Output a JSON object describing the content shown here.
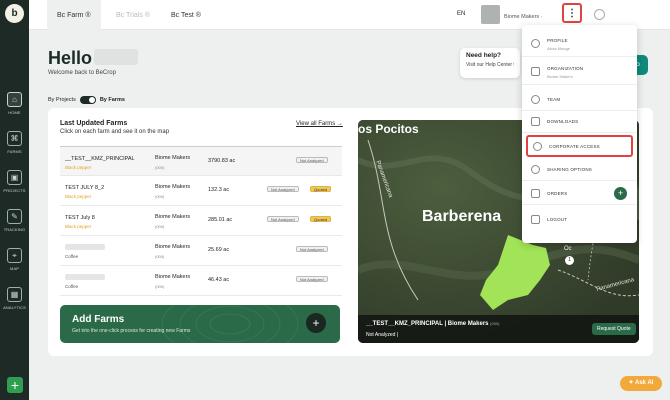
{
  "app": {
    "logo_letter": "b"
  },
  "sidebar": {
    "items": [
      {
        "label": "HOME",
        "icon": "home-icon",
        "glyph": "⌂"
      },
      {
        "label": "FARMS",
        "icon": "farms-icon",
        "glyph": "⌘"
      },
      {
        "label": "PROJECTS",
        "icon": "projects-icon",
        "glyph": "▣"
      },
      {
        "label": "TRACKING",
        "icon": "tracking-icon",
        "glyph": "✎"
      },
      {
        "label": "MAP",
        "icon": "map-icon",
        "glyph": "⌖"
      },
      {
        "label": "ANALYTICS",
        "icon": "analytics-icon",
        "glyph": "▦"
      }
    ],
    "add_glyph": "+"
  },
  "topbar": {
    "tabs": [
      {
        "label": "Bc Farm ®",
        "active": true
      },
      {
        "label": "Bc Trials ®",
        "active": false
      },
      {
        "label": "Bc Test ®",
        "active": false
      }
    ],
    "language": "EN",
    "account": "Biome Makers · ",
    "kebab": "⋮"
  },
  "home": {
    "greeting": "Hello",
    "welcome": "Welcome back to BeCrop",
    "toggle_left": "By Projects",
    "toggle_right": "By Farms"
  },
  "help": {
    "title": "Need help?",
    "subtitle": "Visit our Help Center f",
    "button_glyph": "⌕"
  },
  "farms_card": {
    "title": "Last Updated Farms",
    "subtitle": "Click on each farm and see it on the map",
    "view_all": "View all Farms →",
    "rows": [
      {
        "name": "__TEST__KMZ_PRINCIPAL",
        "crop": "Black pepper",
        "org": "Biome Makers",
        "org_sub": "(000)",
        "area": "3790.83 ac",
        "status": "Not Analyzed",
        "quoted": ""
      },
      {
        "name": "TEST JULY 8_2",
        "crop": "Black pepper",
        "org": "Biome Makers",
        "org_sub": "(000)",
        "area": "132.3 ac",
        "status": "Not Analyzed",
        "quoted": "Quoted"
      },
      {
        "name": "TEST July 8",
        "crop": "Black pepper",
        "org": "Biome Makers",
        "org_sub": "(000)",
        "area": "285.01 ac",
        "status": "Not Analyzed",
        "quoted": "Quoted"
      },
      {
        "name": "",
        "crop": "Coffee",
        "org": "Biome Makers",
        "org_sub": "(000)",
        "area": "25.69 ac",
        "status": "Not Analyzed",
        "quoted": ""
      },
      {
        "name": "",
        "crop": "Coffee",
        "org": "Biome Makers",
        "org_sub": "(000)",
        "area": "46.43 ac",
        "status": "Not Analyzed",
        "quoted": ""
      }
    ],
    "add_farms": {
      "title": "Add Farms",
      "subtitle": "Get into the one-click process for creating new Farms",
      "button_glyph": "+"
    }
  },
  "map": {
    "labels": [
      "os Pocitos",
      "Barberena",
      "Panamericana",
      "Panamericana",
      "Oc",
      "1"
    ],
    "farm_title": "__TEST__KMZ_PRINCIPAL  |  Biome Makers",
    "farm_org": "(000)",
    "farm_status": "Not Analyzed |",
    "quote_button": "Request Quote"
  },
  "menu": {
    "items": [
      {
        "label": "PROFILE",
        "sub": "Alicia Monge",
        "icon": "profile-icon"
      },
      {
        "label": "ORGANIZATION",
        "sub": "Biome Makers",
        "icon": "organization-icon"
      },
      {
        "label": "TEAM",
        "sub": "",
        "icon": "team-icon"
      },
      {
        "label": "DOWNLOADS",
        "sub": "",
        "icon": "downloads-icon"
      },
      {
        "label": "CORPORATE ACCESS",
        "sub": "",
        "icon": "globe-icon"
      },
      {
        "label": "SHARING OPTIONS",
        "sub": "",
        "icon": "share-icon"
      },
      {
        "label": "ORDERS",
        "sub": "",
        "icon": "orders-icon"
      },
      {
        "label": "LOGOUT",
        "sub": "",
        "icon": "logout-icon"
      }
    ],
    "orders_plus": "+"
  },
  "ask_ai": "✦ Ask AI"
}
